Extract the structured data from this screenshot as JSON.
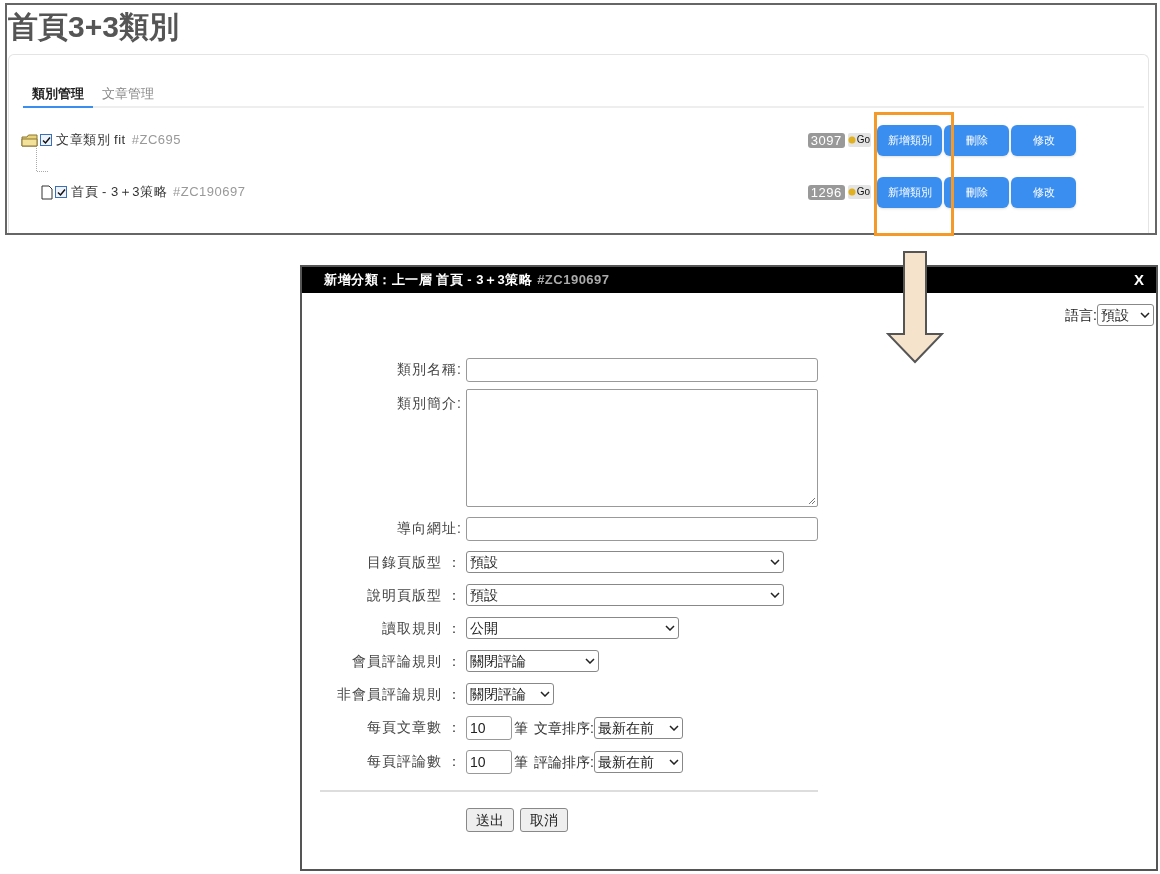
{
  "page_title": "首頁3+3類別",
  "tabs": [
    {
      "label": "類別管理",
      "selected": true
    },
    {
      "label": "文章管理",
      "selected": false
    }
  ],
  "tree": [
    {
      "name": "文章類別 fit",
      "code": "#ZC695",
      "checked": true,
      "count": "3097",
      "go": "Go",
      "actions": [
        "新增類別",
        "刪除",
        "修改"
      ],
      "children": [
        {
          "name": "首頁 - 3＋3策略",
          "code": "#ZC190697",
          "checked": true,
          "count": "1296",
          "go": "Go",
          "actions": [
            "新增類別",
            "刪除",
            "修改"
          ]
        }
      ]
    }
  ],
  "dialog": {
    "title": "新增分類：上一層 首頁 - 3＋3策略",
    "title_code": "#ZC190697",
    "close": "X",
    "language": {
      "label": "語言:",
      "value": "預設"
    },
    "fields": [
      {
        "kind": "text",
        "label": "類別名稱:"
      },
      {
        "kind": "textarea",
        "label": "類別簡介:"
      },
      {
        "kind": "text",
        "label": "導向網址:"
      },
      {
        "kind": "select",
        "label": "目錄頁版型 ：",
        "value": "預設"
      },
      {
        "kind": "select",
        "label": "說明頁版型 ：",
        "value": "預設"
      },
      {
        "kind": "select",
        "label": "讀取規則 ：",
        "value": "公開"
      },
      {
        "kind": "select",
        "label": "會員評論規則 ：",
        "value": "關閉評論"
      },
      {
        "kind": "select",
        "label": "非會員評論規則 ：",
        "value": "關閉評論"
      },
      {
        "kind": "count",
        "label": "每頁文章數 ：",
        "value": "10",
        "unit": "筆",
        "sort_label": "文章排序:",
        "sort_value": "最新在前"
      },
      {
        "kind": "count",
        "label": "每頁評論數 ：",
        "value": "10",
        "unit": "筆",
        "sort_label": "評論排序:",
        "sort_value": "最新在前"
      }
    ],
    "buttons": [
      "送出",
      "取消"
    ]
  }
}
